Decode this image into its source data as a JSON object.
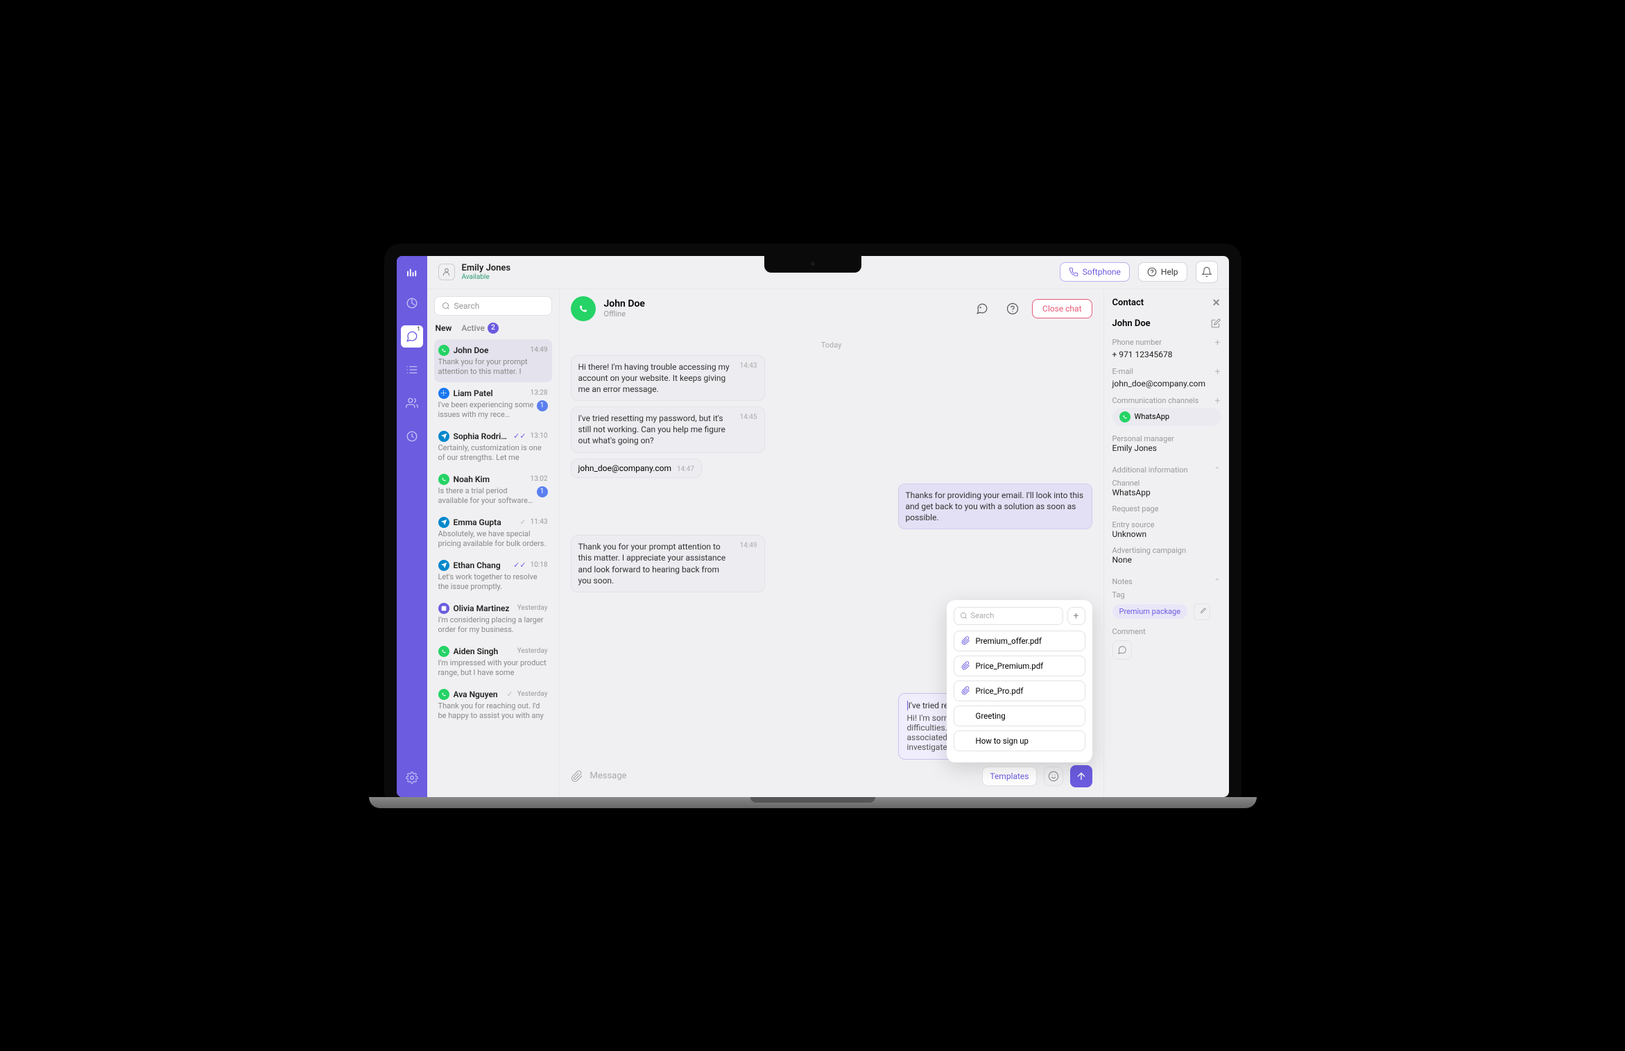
{
  "agent": {
    "name": "Emily Jones",
    "status": "Available"
  },
  "topbar": {
    "softphone": "Softphone",
    "help": "Help"
  },
  "rail": {
    "chat_badge": "1"
  },
  "search_placeholder": "Search",
  "tabs": {
    "new": "New",
    "active": "Active",
    "active_count": "2"
  },
  "conversations": [
    {
      "channel": "wa",
      "name": "John Doe",
      "time": "14:49",
      "preview": "Thank you for your prompt attention to this matter. I",
      "selected": true
    },
    {
      "channel": "fb",
      "name": "Liam Patel",
      "time": "13:28",
      "preview": "I've been experiencing some issues with my rece…",
      "unread": "1"
    },
    {
      "channel": "tg",
      "name": "Sophia Rodriguez",
      "time": "13:10",
      "preview": "Certainly, customization is one of our strengths. Let me",
      "read": true
    },
    {
      "channel": "wa",
      "name": "Noah Kim",
      "time": "13:02",
      "preview": "Is there a trial period available for your software…",
      "unread": "1"
    },
    {
      "channel": "tg",
      "name": "Emma Gupta",
      "time": "11:43",
      "preview": "Absolutely, we have special pricing available for bulk orders.",
      "sent": true
    },
    {
      "channel": "tg",
      "name": "Ethan Chang",
      "time": "10:18",
      "preview": "Let's work together to resolve the issue promptly.",
      "read": true
    },
    {
      "channel": "dc",
      "name": "Olivia Martinez",
      "time": "Yesterday",
      "preview": "I'm considering placing a larger order for my business."
    },
    {
      "channel": "wa",
      "name": "Aiden Singh",
      "time": "Yesterday",
      "preview": "I'm impressed with your product range, but I have some"
    },
    {
      "channel": "wa",
      "name": "Ava Nguyen",
      "time": "Yesterday",
      "preview": "Thank you for reaching out. I'd be happy to assist you with any",
      "sent": true
    }
  ],
  "chat": {
    "name": "John Doe",
    "status": "Offline",
    "close": "Close chat",
    "date_separator": "Today",
    "messages": [
      {
        "dir": "in",
        "text": "Hi there! I'm having trouble accessing my account on your website. It keeps giving me an error message.",
        "time": "14:43"
      },
      {
        "dir": "in",
        "text": "I've tried resetting my password, but it's still not working. Can you help me figure out what's going on?",
        "time": "14:45"
      },
      {
        "dir": "email",
        "text": "john_doe@company.com",
        "time": "14:47"
      },
      {
        "dir": "out",
        "text": "Thanks for providing your email. I'll look into this and get back to you with a solution as soon as possible.",
        "time": ""
      },
      {
        "dir": "in",
        "text": "Thank you for your prompt attention to this matter. I appreciate your assistance and look forward to hearing back from you soon.",
        "time": "14:49"
      }
    ],
    "draft": {
      "typed": "I've tried reset",
      "body": "Hi! I'm sorry to hear you're facing login difficulties. Could you share the email associated with your account so I can investigate further?"
    },
    "composer": {
      "placeholder": "Message",
      "templates": "Templates"
    }
  },
  "templates": {
    "search": "Search",
    "items": [
      {
        "label": "Premium_offer.pdf",
        "file": true
      },
      {
        "label": "Price_Premium.pdf",
        "file": true
      },
      {
        "label": "Price_Pro.pdf",
        "file": true
      },
      {
        "label": "Greeting",
        "file": false
      },
      {
        "label": "How to sign up",
        "file": false
      }
    ]
  },
  "contact": {
    "title": "Contact",
    "name": "John Doe",
    "labels": {
      "phone": "Phone number",
      "email": "E-mail",
      "channels": "Communication channels",
      "manager": "Personal manager",
      "additional": "Additional information",
      "channel": "Channel",
      "request": "Request page",
      "entry": "Entry source",
      "campaign": "Advertising campaign",
      "notes": "Notes",
      "tag": "Tag",
      "comment": "Comment"
    },
    "phone": "+ 971 12345678",
    "email": "john_doe@company.com",
    "channel_name": "WhatsApp",
    "manager": "Emily Jones",
    "channel_val": "WhatsApp",
    "entry_val": "Unknown",
    "campaign_val": "None",
    "tag_val": "Premium package"
  }
}
